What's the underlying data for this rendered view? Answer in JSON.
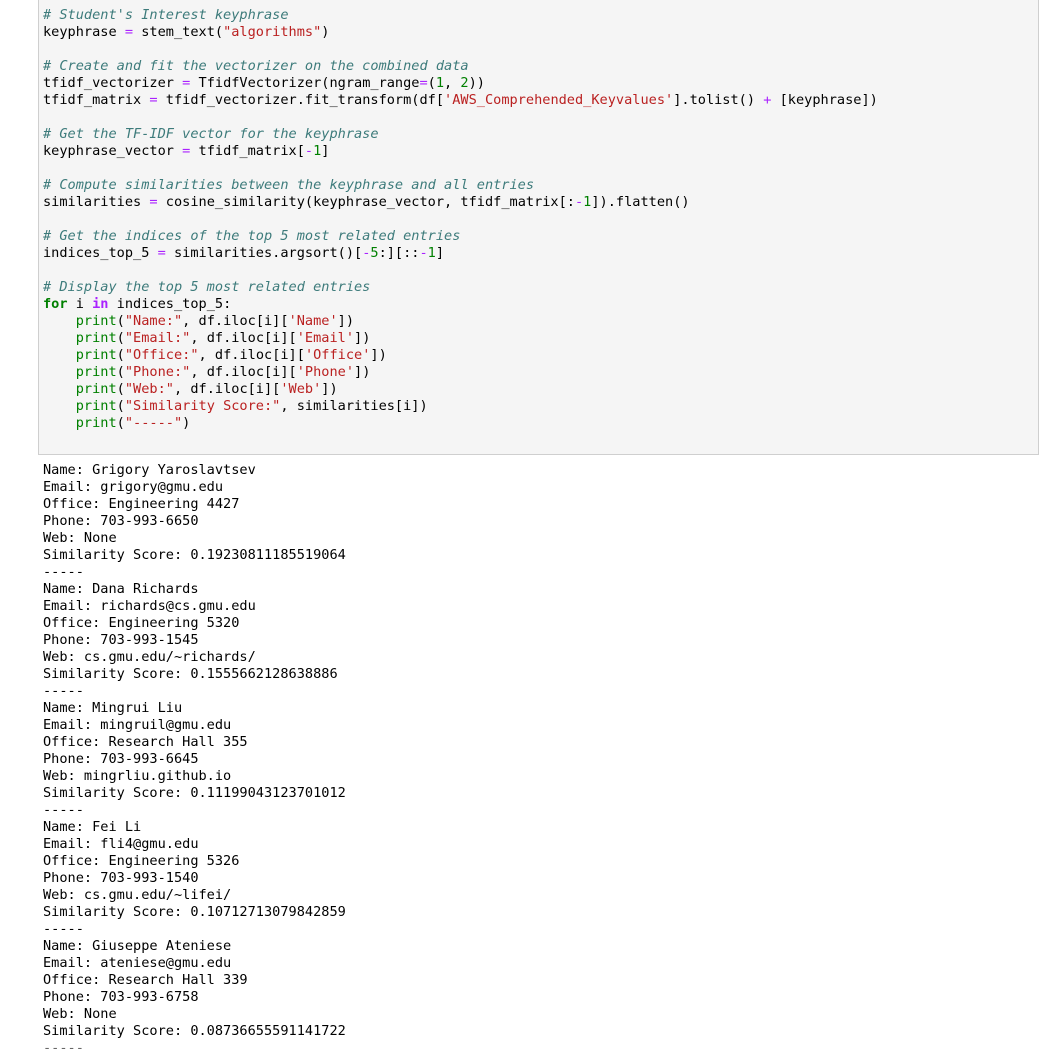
{
  "code_cell": {
    "lines": [
      [
        {
          "t": "cm",
          "v": "# Student's Interest keyphrase"
        }
      ],
      [
        {
          "t": "",
          "v": "keyphrase "
        },
        {
          "t": "op",
          "v": "="
        },
        {
          "t": "",
          "v": " stem_text("
        },
        {
          "t": "st",
          "v": "\"algorithms\""
        },
        {
          "t": "",
          "v": ")"
        }
      ],
      [],
      [
        {
          "t": "cm",
          "v": "# Create and fit the vectorizer on the combined data"
        }
      ],
      [
        {
          "t": "",
          "v": "tfidf_vectorizer "
        },
        {
          "t": "op",
          "v": "="
        },
        {
          "t": "",
          "v": " TfidfVectorizer(ngram_range"
        },
        {
          "t": "op",
          "v": "="
        },
        {
          "t": "",
          "v": "("
        },
        {
          "t": "nm",
          "v": "1"
        },
        {
          "t": "",
          "v": ", "
        },
        {
          "t": "nm",
          "v": "2"
        },
        {
          "t": "",
          "v": "))"
        }
      ],
      [
        {
          "t": "",
          "v": "tfidf_matrix "
        },
        {
          "t": "op",
          "v": "="
        },
        {
          "t": "",
          "v": " tfidf_vectorizer.fit_transform(df["
        },
        {
          "t": "st",
          "v": "'AWS_Comprehended_Keyvalues'"
        },
        {
          "t": "",
          "v": "].tolist() "
        },
        {
          "t": "op",
          "v": "+"
        },
        {
          "t": "",
          "v": " [keyphrase])"
        }
      ],
      [],
      [
        {
          "t": "cm",
          "v": "# Get the TF-IDF vector for the keyphrase"
        }
      ],
      [
        {
          "t": "",
          "v": "keyphrase_vector "
        },
        {
          "t": "op",
          "v": "="
        },
        {
          "t": "",
          "v": " tfidf_matrix["
        },
        {
          "t": "op",
          "v": "-"
        },
        {
          "t": "nm",
          "v": "1"
        },
        {
          "t": "",
          "v": "]"
        }
      ],
      [],
      [
        {
          "t": "cm",
          "v": "# Compute similarities between the keyphrase and all entries"
        }
      ],
      [
        {
          "t": "",
          "v": "similarities "
        },
        {
          "t": "op",
          "v": "="
        },
        {
          "t": "",
          "v": " cosine_similarity(keyphrase_vector, tfidf_matrix[:"
        },
        {
          "t": "op",
          "v": "-"
        },
        {
          "t": "nm",
          "v": "1"
        },
        {
          "t": "",
          "v": "]).flatten()"
        }
      ],
      [],
      [
        {
          "t": "cm",
          "v": "# Get the indices of the top 5 most related entries"
        }
      ],
      [
        {
          "t": "",
          "v": "indices_top_5 "
        },
        {
          "t": "op",
          "v": "="
        },
        {
          "t": "",
          "v": " similarities.argsort()["
        },
        {
          "t": "op",
          "v": "-"
        },
        {
          "t": "nm",
          "v": "5"
        },
        {
          "t": "",
          "v": ":][::"
        },
        {
          "t": "op",
          "v": "-"
        },
        {
          "t": "nm",
          "v": "1"
        },
        {
          "t": "",
          "v": "]"
        }
      ],
      [],
      [
        {
          "t": "cm",
          "v": "# Display the top 5 most related entries"
        }
      ],
      [
        {
          "t": "kw",
          "v": "for"
        },
        {
          "t": "",
          "v": " i "
        },
        {
          "t": "ow",
          "v": "in"
        },
        {
          "t": "",
          "v": " indices_top_5:"
        }
      ],
      [
        {
          "t": "",
          "v": "    "
        },
        {
          "t": "bi",
          "v": "print"
        },
        {
          "t": "",
          "v": "("
        },
        {
          "t": "st",
          "v": "\"Name:\""
        },
        {
          "t": "",
          "v": ", df.iloc[i]["
        },
        {
          "t": "st",
          "v": "'Name'"
        },
        {
          "t": "",
          "v": "])"
        }
      ],
      [
        {
          "t": "",
          "v": "    "
        },
        {
          "t": "bi",
          "v": "print"
        },
        {
          "t": "",
          "v": "("
        },
        {
          "t": "st",
          "v": "\"Email:\""
        },
        {
          "t": "",
          "v": ", df.iloc[i]["
        },
        {
          "t": "st",
          "v": "'Email'"
        },
        {
          "t": "",
          "v": "])"
        }
      ],
      [
        {
          "t": "",
          "v": "    "
        },
        {
          "t": "bi",
          "v": "print"
        },
        {
          "t": "",
          "v": "("
        },
        {
          "t": "st",
          "v": "\"Office:\""
        },
        {
          "t": "",
          "v": ", df.iloc[i]["
        },
        {
          "t": "st",
          "v": "'Office'"
        },
        {
          "t": "",
          "v": "])"
        }
      ],
      [
        {
          "t": "",
          "v": "    "
        },
        {
          "t": "bi",
          "v": "print"
        },
        {
          "t": "",
          "v": "("
        },
        {
          "t": "st",
          "v": "\"Phone:\""
        },
        {
          "t": "",
          "v": ", df.iloc[i]["
        },
        {
          "t": "st",
          "v": "'Phone'"
        },
        {
          "t": "",
          "v": "])"
        }
      ],
      [
        {
          "t": "",
          "v": "    "
        },
        {
          "t": "bi",
          "v": "print"
        },
        {
          "t": "",
          "v": "("
        },
        {
          "t": "st",
          "v": "\"Web:\""
        },
        {
          "t": "",
          "v": ", df.iloc[i]["
        },
        {
          "t": "st",
          "v": "'Web'"
        },
        {
          "t": "",
          "v": "])"
        }
      ],
      [
        {
          "t": "",
          "v": "    "
        },
        {
          "t": "bi",
          "v": "print"
        },
        {
          "t": "",
          "v": "("
        },
        {
          "t": "st",
          "v": "\"Similarity Score:\""
        },
        {
          "t": "",
          "v": ", similarities[i])"
        }
      ],
      [
        {
          "t": "",
          "v": "    "
        },
        {
          "t": "bi",
          "v": "print"
        },
        {
          "t": "",
          "v": "("
        },
        {
          "t": "st",
          "v": "\"-----\""
        },
        {
          "t": "",
          "v": ")"
        }
      ]
    ]
  },
  "output": {
    "lines": [
      "Name: Grigory Yaroslavtsev",
      "Email: grigory@gmu.edu",
      "Office: Engineering 4427",
      "Phone: 703-993-6650",
      "Web: None",
      "Similarity Score: 0.19230811185519064",
      "-----",
      "Name: Dana Richards",
      "Email: richards@cs.gmu.edu",
      "Office: Engineering 5320",
      "Phone: 703-993-1545",
      "Web: cs.gmu.edu/~richards/",
      "Similarity Score: 0.1555662128638886",
      "-----",
      "Name: Mingrui Liu",
      "Email: mingruil@gmu.edu",
      "Office: Research Hall 355",
      "Phone: 703-993-6645",
      "Web: mingrliu.github.io",
      "Similarity Score: 0.11199043123701012",
      "-----",
      "Name: Fei Li",
      "Email: fli4@gmu.edu",
      "Office: Engineering 5326",
      "Phone: 703-993-1540",
      "Web: cs.gmu.edu/~lifei/",
      "Similarity Score: 0.10712713079842859",
      "-----",
      "Name: Giuseppe Ateniese",
      "Email: ateniese@gmu.edu",
      "Office: Research Hall 339",
      "Phone: 703-993-6758",
      "Web: None",
      "Similarity Score: 0.08736655591141722",
      "-----"
    ]
  }
}
